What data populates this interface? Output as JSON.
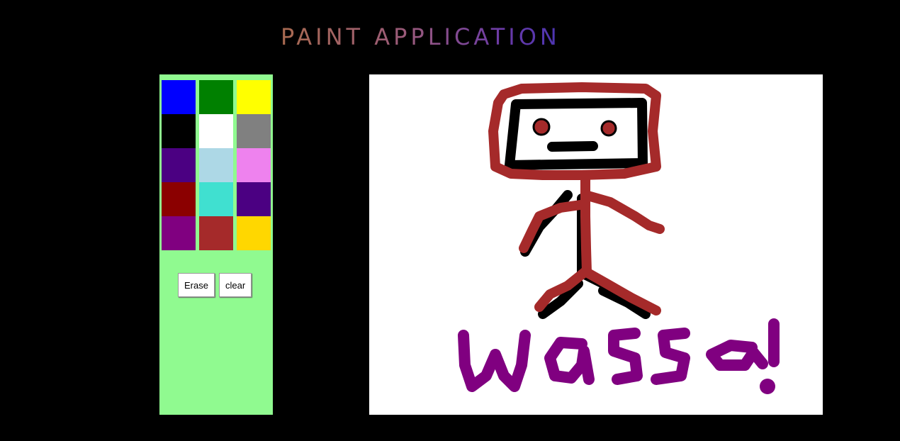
{
  "app": {
    "title": "PAINT APPLICATION"
  },
  "palette": {
    "swatches": [
      {
        "name": "blue",
        "color": "#0000ff"
      },
      {
        "name": "green",
        "color": "#008000"
      },
      {
        "name": "yellow",
        "color": "#ffff00"
      },
      {
        "name": "black",
        "color": "#000000"
      },
      {
        "name": "white",
        "color": "#ffffff"
      },
      {
        "name": "gray",
        "color": "#808080"
      },
      {
        "name": "indigo",
        "color": "#4b0082"
      },
      {
        "name": "lightblue",
        "color": "#add8e6"
      },
      {
        "name": "violet",
        "color": "#ee82ee"
      },
      {
        "name": "darkred",
        "color": "#8b0000"
      },
      {
        "name": "turquoise",
        "color": "#40e0d0"
      },
      {
        "name": "indigo-2",
        "color": "#4b0082"
      },
      {
        "name": "purple",
        "color": "#800080"
      },
      {
        "name": "brown",
        "color": "#a52a2a"
      },
      {
        "name": "gold",
        "color": "#ffd700"
      }
    ],
    "panel_color": "#90fa90"
  },
  "tools": {
    "erase_label": "Erase",
    "clear_label": "clear"
  },
  "canvas": {
    "background": "#ffffff",
    "drawing": {
      "stroke_colors": [
        "#a52a2a",
        "#000000",
        "#800080"
      ]
    }
  }
}
